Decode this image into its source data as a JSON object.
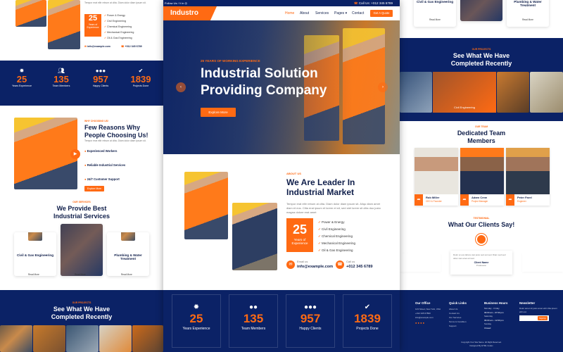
{
  "topbar": {
    "follow": "Follow Us:",
    "call": "Call Us: +012 345 6789"
  },
  "nav": {
    "brand": "Industro",
    "items": [
      "Home",
      "About",
      "Services",
      "Pages",
      "Contact"
    ],
    "cta": "Get A Quote"
  },
  "hero": {
    "eyebrow": "25 YEARS OF WORKING EXPERIENCE",
    "title1": "Industrial Solution",
    "title2": "Providing Company",
    "button": "Explore More"
  },
  "about": {
    "eyebrow": "ABOUT US",
    "title1": "We Are Leader In",
    "title2": "Industrial Market",
    "text": "Tempor erat elitr rebum at clita. Diam dolor diam ipsum sit. Aliqu diam amet diam et eos. Clita erat ipsum et lorem et sit, sed stet lorem sit clita duo justo magna dolore erat amet",
    "exp_num": "25",
    "exp_l1": "Years of",
    "exp_l2": "Experience",
    "checks": [
      "Power & Energy",
      "Civil Engineering",
      "Chemical Engineering",
      "Mechanical Engineering",
      "Oil & Gas Engineering"
    ],
    "email_lbl": "Email us",
    "email": "info@example.com",
    "call_lbl": "Call us",
    "phone": "+012 345 6789"
  },
  "stats": [
    {
      "num": "25",
      "label": "Years Experience"
    },
    {
      "num": "135",
      "label": "Team Members"
    },
    {
      "num": "957",
      "label": "Happy Clients"
    },
    {
      "num": "1839",
      "label": "Projects Done"
    }
  ],
  "left": {
    "exp_num": "25",
    "exp_l1": "Years of",
    "exp_l2": "Experience",
    "checks": [
      "Power & Energy",
      "Civil Engineering",
      "Chemical Engineering",
      "Mechanical Engineering",
      "Oil & Gas Engineering"
    ],
    "email": "info@example.com",
    "phone": "+012 345 6789",
    "why_eyebrow": "WHY CHOOSING US!",
    "why_title1": "Few Reasons Why",
    "why_title2": "People Choosing Us!",
    "why_items": [
      "Experienced Workers",
      "Reliable Industrial Services",
      "24/7 Customer Support"
    ],
    "why_btn": "Explore More",
    "serv_eyebrow": "OUR SERVICES",
    "serv_title1": "We Provide Best",
    "serv_title2": "Industrial Services",
    "services": [
      "Civil & Gas Engineering",
      "",
      "Plumbing & Water Treatment"
    ],
    "read": "Read More",
    "proj_eyebrow": "OUR PROJECTS",
    "proj_title1": "See What We Have",
    "proj_title2": "Completed Recently"
  },
  "right": {
    "services": [
      "Civil & Gas Engineering",
      "Plumbing & Water Treatment"
    ],
    "read": "Read More",
    "proj_eyebrow": "OUR PROJECTS",
    "proj_title1": "See What We Have",
    "proj_title2": "Completed Recently",
    "proj_tag": "Civil Engineering",
    "team_eyebrow": "OUR TEAM",
    "team_title1": "Dedicated Team",
    "team_title2": "Members",
    "team": [
      {
        "name": "Rob Miller",
        "role": "CEO & Founder"
      },
      {
        "name": "Adam Crew",
        "role": "Project Manager"
      },
      {
        "name": "Peter Farel",
        "role": "Engineer"
      }
    ],
    "test_eyebrow": "TESTIMONIAL",
    "test_title": "What Our Clients Say!",
    "client": "Client Name",
    "prof": "Profession",
    "footer": {
      "office": "Our Office",
      "links": "Quick Links",
      "hours": "Business Hours",
      "news": "Newsletter",
      "addr": "123 Street, New York, USA",
      "ph": "+012 345 67890",
      "mail": "info@example.com",
      "lk": [
        "About Us",
        "Contact Us",
        "Our Services",
        "Terms & Condition",
        "Support"
      ],
      "h1": "Monday - Friday",
      "h1v": "09:00 am - 07:00 pm",
      "h2": "Saturday",
      "h2v": "09:00 am - 12:00 pm",
      "h3": "Sunday",
      "h3v": "Closed",
      "sign": "SignUp",
      "copy": "Copyright Your Site Name. All Right Reserved.",
      "design": "Designed By HTML Codex"
    }
  }
}
